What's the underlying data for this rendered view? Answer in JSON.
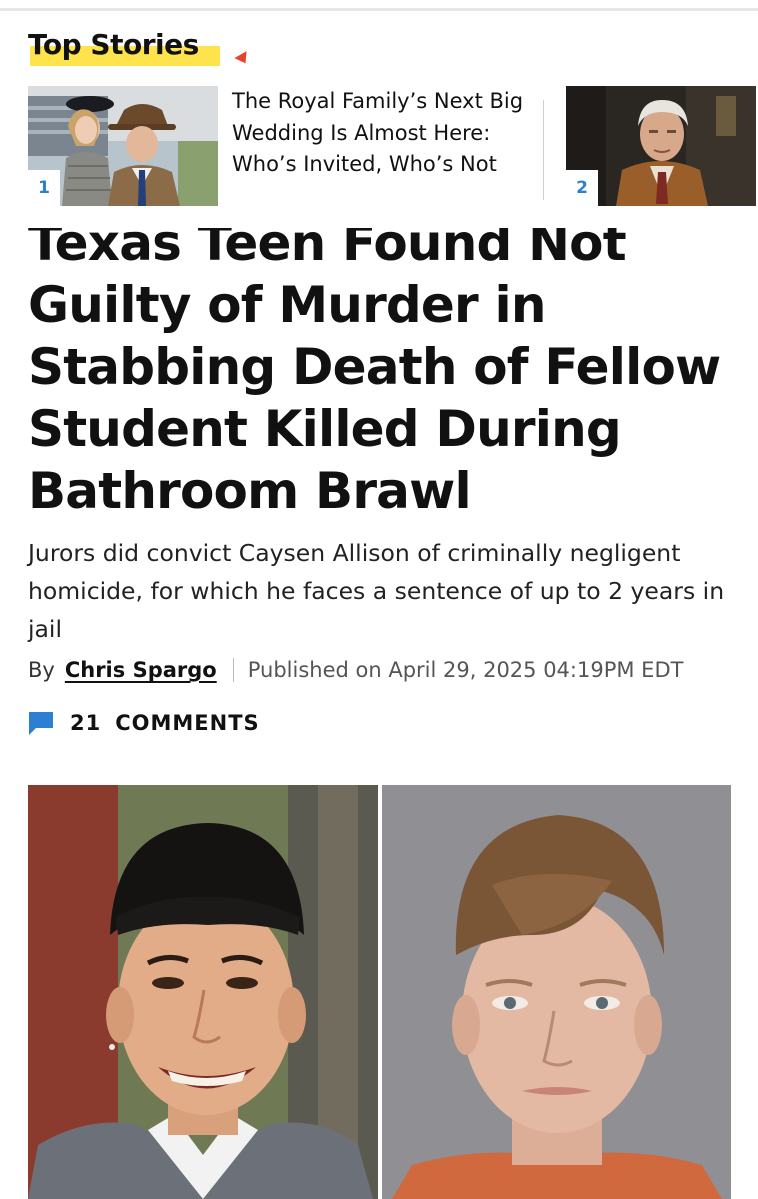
{
  "top_stories": {
    "title": "Top Stories",
    "items": [
      {
        "rank": "1",
        "headline": "The Royal Family’s Next Big Wedding Is Almost Here: Who’s Invited, Who’s Not"
      },
      {
        "rank": "2"
      }
    ]
  },
  "article": {
    "headline": "Texas Teen Found Not Guilty of Murder in Stabbing Death of Fellow Student Killed During Bathroom Brawl",
    "dek": "Jurors did convict Caysen Allison of criminally negligent homicide, for which he faces a sentence of up to 2 years in jail",
    "byline": {
      "by": "By",
      "author": "Chris Spargo",
      "published": "Published on April 29, 2025 04:19PM EDT"
    },
    "comments": {
      "count": "21",
      "label": "COMMENTS",
      "icon": "comment-bubble-icon"
    }
  },
  "colors": {
    "highlight": "#ffe34d",
    "accent_blue": "#2d7fd1",
    "arrow_red": "#e8432e"
  }
}
